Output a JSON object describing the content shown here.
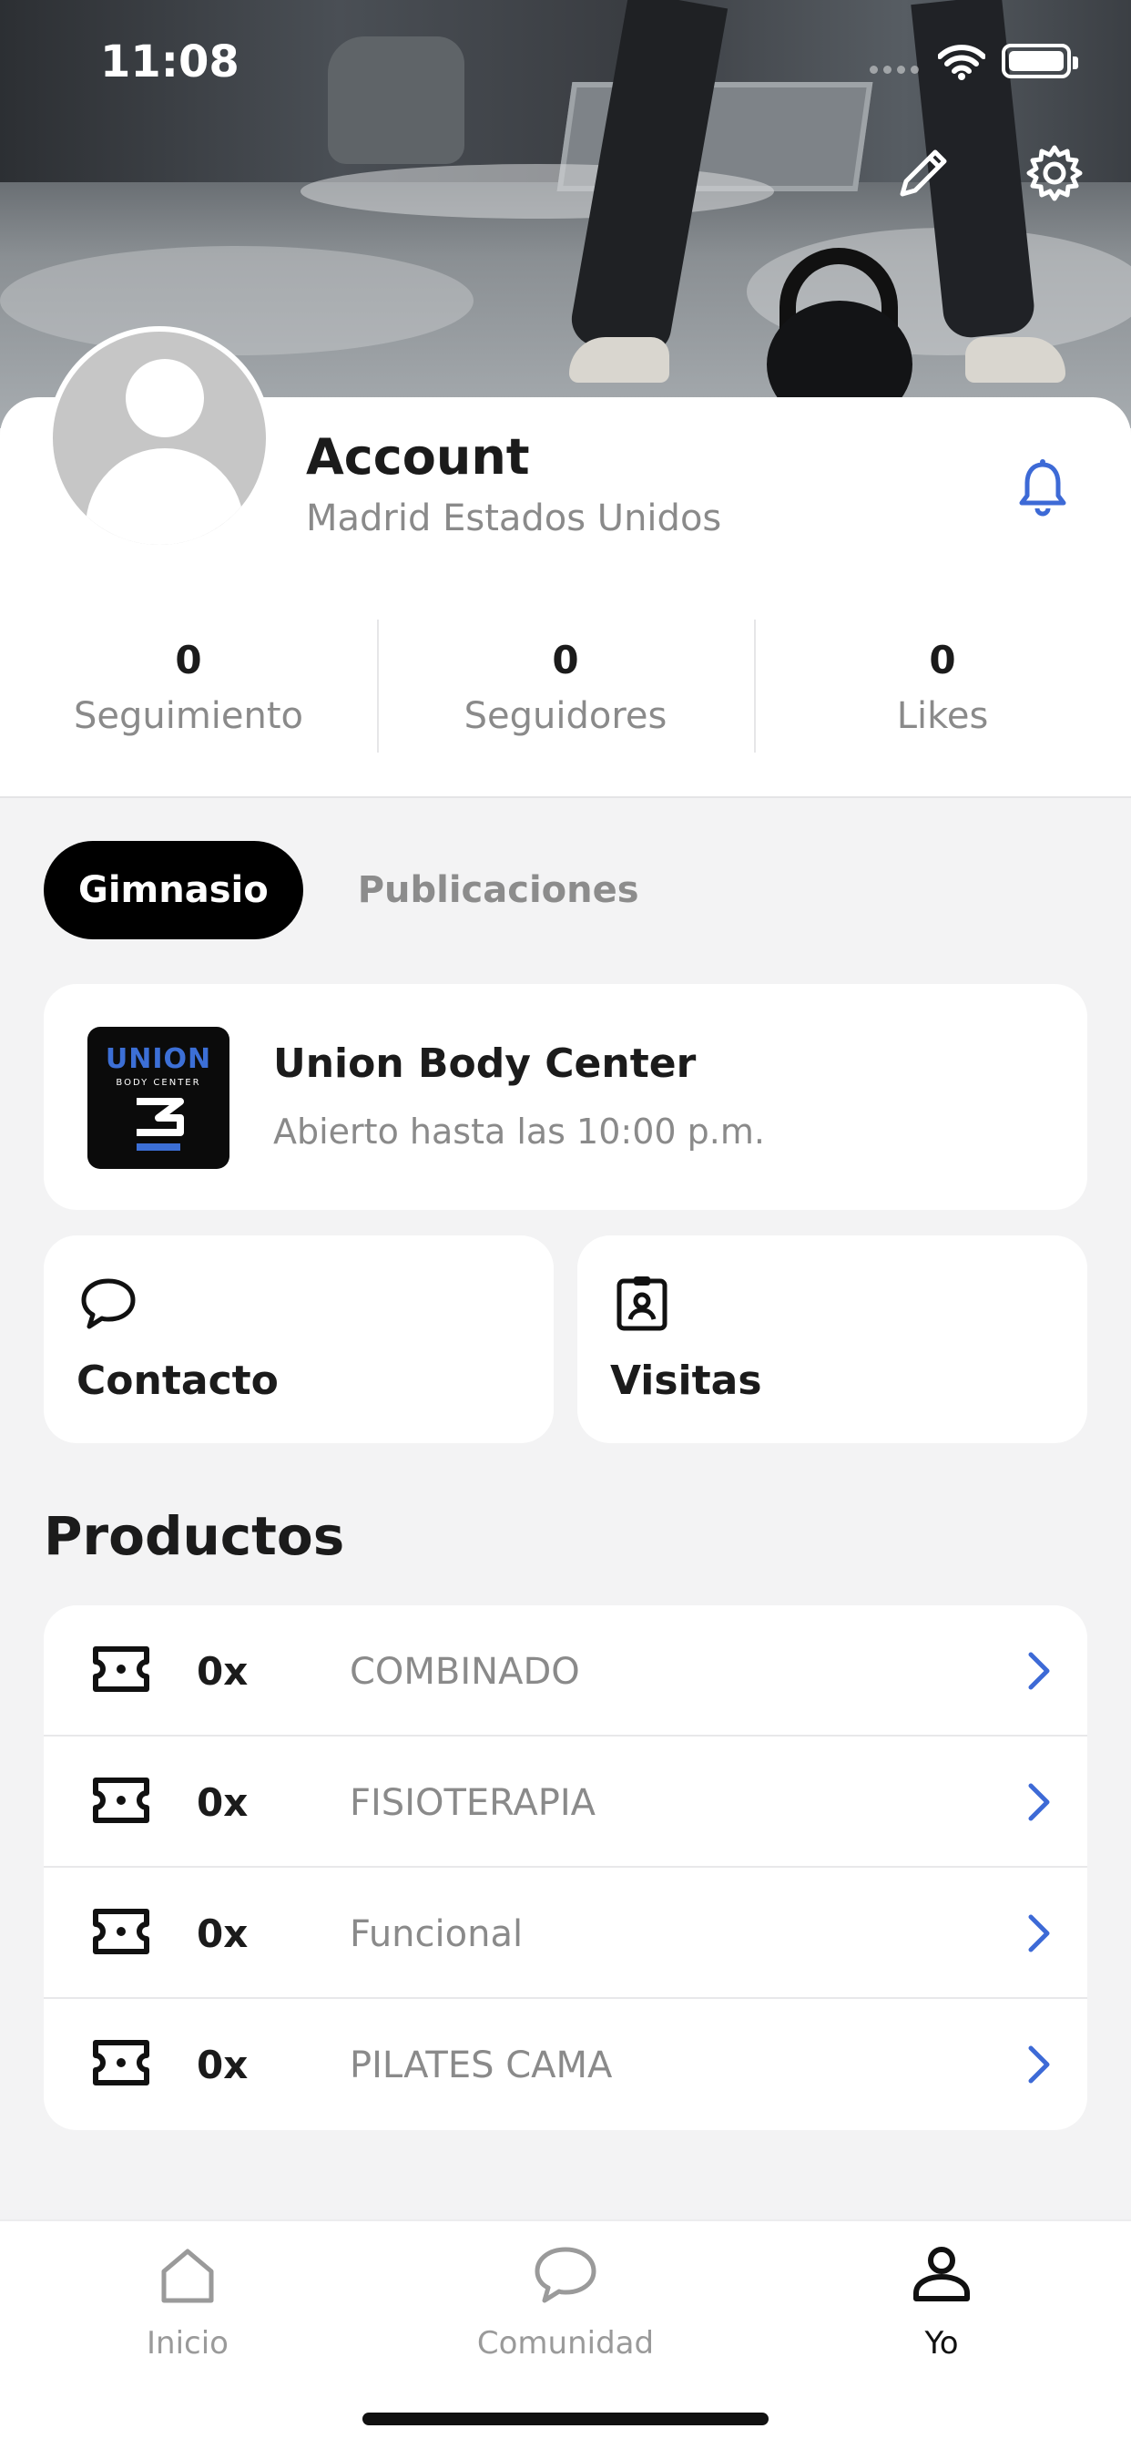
{
  "status_bar": {
    "time": "11:08"
  },
  "profile": {
    "name": "Account",
    "location": "Madrid Estados Unidos",
    "stats": [
      {
        "value": "0",
        "label": "Seguimiento"
      },
      {
        "value": "0",
        "label": "Seguidores"
      },
      {
        "value": "0",
        "label": "Likes"
      }
    ]
  },
  "tabs": {
    "active": "Gimnasio",
    "other": "Publicaciones"
  },
  "gym": {
    "name": "Union Body Center",
    "hours": "Abierto hasta las 10:00 p.m.",
    "logo_text": "UNION",
    "logo_subtext": "BODY CENTER"
  },
  "actions": {
    "contact": "Contacto",
    "visits": "Visitas"
  },
  "products": {
    "title": "Productos",
    "items": [
      {
        "qty": "0x",
        "name": "COMBINADO"
      },
      {
        "qty": "0x",
        "name": "FISIOTERAPIA"
      },
      {
        "qty": "0x",
        "name": "Funcional"
      },
      {
        "qty": "0x",
        "name": "PILATES CAMA"
      }
    ]
  },
  "tabbar": {
    "home": "Inicio",
    "community": "Comunidad",
    "me": "Yo"
  },
  "colors": {
    "accent": "#3d6ad6",
    "text": "#1b1b1b",
    "muted": "#8a8a8a"
  }
}
